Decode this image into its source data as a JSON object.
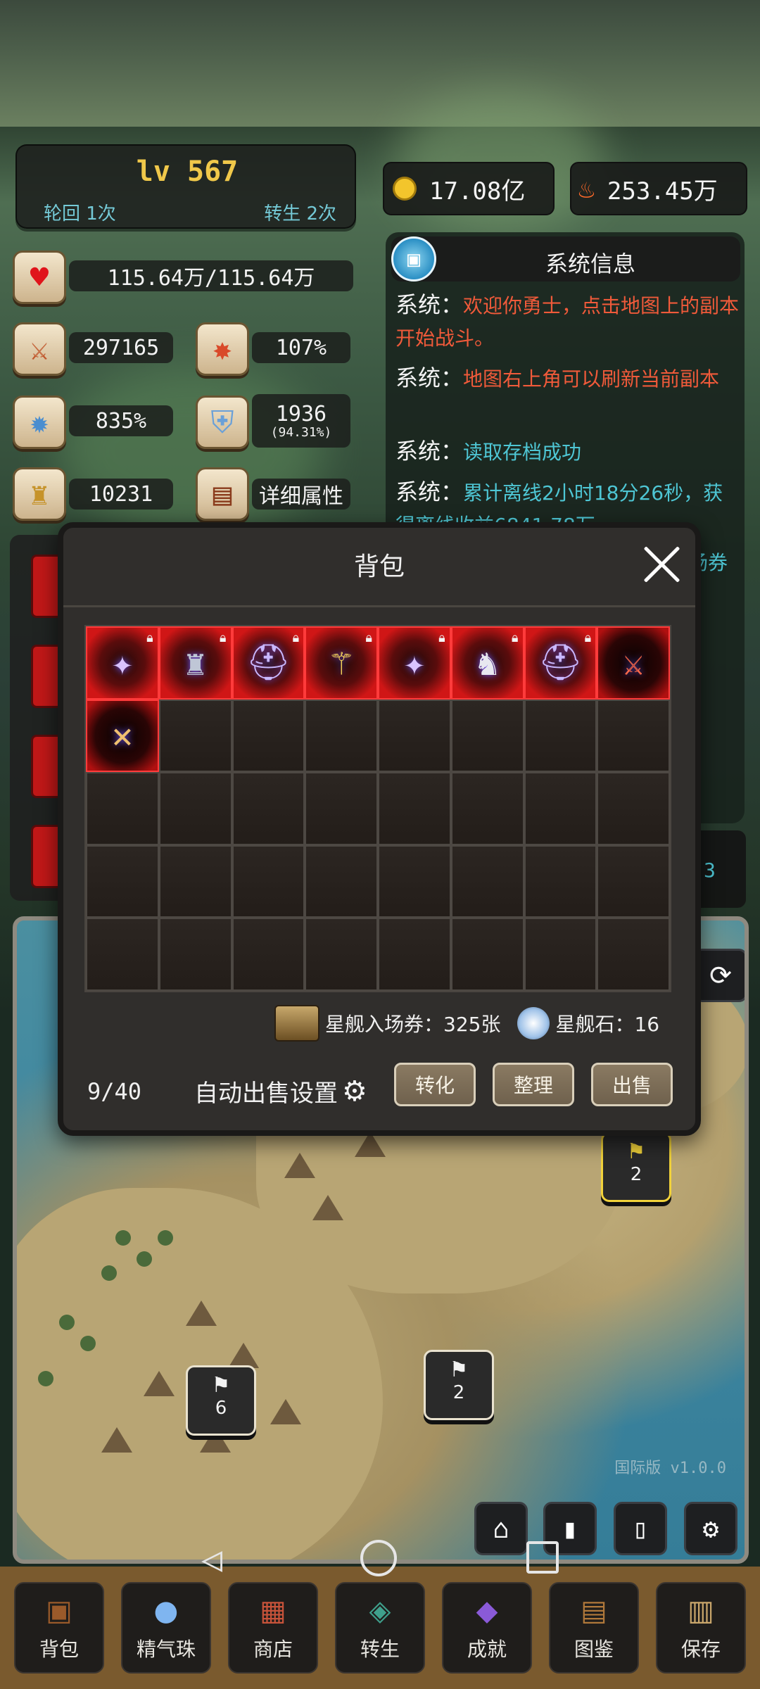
{
  "header": {
    "level": "lv 567",
    "lunhui": "轮回 1次",
    "zhuansheng": "转生 2次"
  },
  "currency": {
    "gold": "17.08亿",
    "fire": "253.45万"
  },
  "stats": {
    "hp": "115.64万/115.64万",
    "attack": "297165",
    "crit": "107%",
    "crit_damage": "835%",
    "defense": "1936",
    "defense_pct": "(94.31%)",
    "power": "10231",
    "detail_label": "详细属性"
  },
  "system_panel": {
    "title": "系统信息",
    "messages": [
      {
        "label": "系统：",
        "text": "欢迎你勇士，点击地图上的副本开始战斗。",
        "color": "red"
      },
      {
        "label": "系统：",
        "text": "地图右上角可以刷新当前副本",
        "color": "red"
      },
      {
        "label": "系统：",
        "text": "读取存档成功",
        "color": "cyan"
      },
      {
        "label": "系统：",
        "text": "累计离线2小时18分26秒，获得离线收益6841.78万",
        "color": "cyan"
      }
    ],
    "partial_right": "场券",
    "mini_value": "3"
  },
  "bag": {
    "title": "背包",
    "capacity": "9/40",
    "auto_sell_label": "自动出售设置",
    "ticket_label": "星舰入场券：325张",
    "stone_label": "星舰石：16",
    "buttons": {
      "convert": "转化",
      "sort": "整理",
      "sell": "出售"
    },
    "items": [
      {
        "icon": "staff-orb-icon",
        "locked": true
      },
      {
        "icon": "dark-armor-icon",
        "locked": true
      },
      {
        "icon": "dark-helmet-icon",
        "locked": true
      },
      {
        "icon": "golden-staff-icon",
        "locked": true
      },
      {
        "icon": "staff-orb-icon",
        "locked": true
      },
      {
        "icon": "cloak-armor-icon",
        "locked": true
      },
      {
        "icon": "dark-helmet-icon",
        "locked": true
      },
      {
        "icon": "red-sword-icon",
        "locked": false
      },
      {
        "icon": "crossed-swords-icon",
        "locked": false
      }
    ]
  },
  "map": {
    "markers": [
      {
        "label": "2"
      },
      {
        "label": "2"
      },
      {
        "label": "6"
      }
    ],
    "version": "国际版 v1.0.0"
  },
  "bottom_nav": [
    {
      "label": "背包",
      "icon": "backpack-icon"
    },
    {
      "label": "精气珠",
      "icon": "orb-icon"
    },
    {
      "label": "商店",
      "icon": "shop-icon"
    },
    {
      "label": "转生",
      "icon": "rebirth-icon"
    },
    {
      "label": "成就",
      "icon": "achievement-icon"
    },
    {
      "label": "图鉴",
      "icon": "codex-icon"
    },
    {
      "label": "保存",
      "icon": "save-icon"
    }
  ]
}
